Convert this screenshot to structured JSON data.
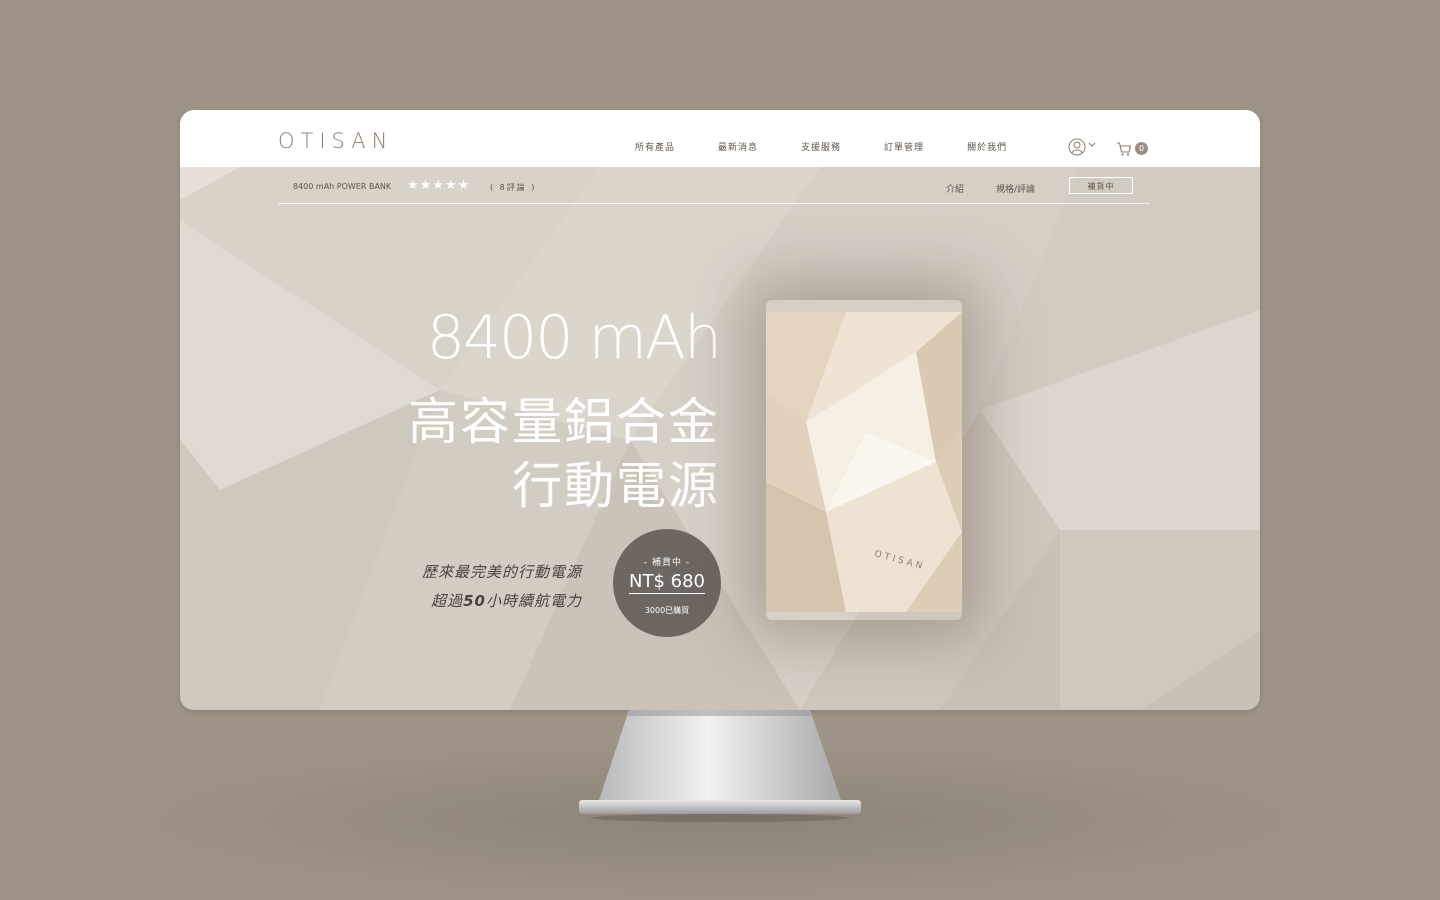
{
  "header": {
    "logo": "OTISAN",
    "nav": [
      "所有產品",
      "最新消息",
      "支援服務",
      "訂單管理",
      "關於我們"
    ],
    "cart_count": "0",
    "icons": [
      "user-icon",
      "chevron-down-icon",
      "cart-icon"
    ]
  },
  "subbar": {
    "product_name": "8400 mAh POWER BANK",
    "stars": "★★★★★",
    "rating": 5,
    "reviews": "( 8評論 )",
    "link_intro": "介紹",
    "link_specs": "規格/評論",
    "restock_button": "補貨中"
  },
  "hero": {
    "line1": "8400 mAh",
    "line2": "高容量鋁合金",
    "line3": "行動電源",
    "tagline1": "歷來最完美的行動電源",
    "tagline2_pre": "超過",
    "tagline2_num": "50",
    "tagline2_post": "小時續航電力"
  },
  "badge": {
    "status": "- 補貨中 -",
    "price": "NT$ 680",
    "sold": "3000已購買"
  },
  "product": {
    "engraving": "OTISAN"
  },
  "colors": {
    "background": "#9d9386",
    "hero": "#d7d0c7",
    "badge": "#6e6661",
    "product": "#efe3cf"
  }
}
